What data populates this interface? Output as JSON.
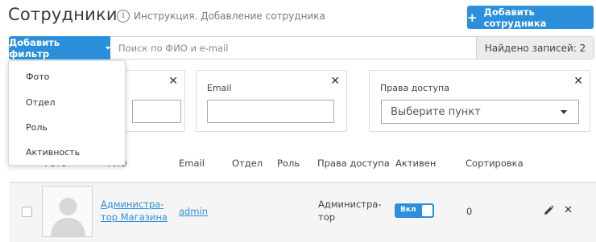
{
  "header": {
    "title": "Сотрудники",
    "help_icon": "info-icon",
    "help_link": "Инструкция. Добавление сотрудника",
    "add_button": "Добавить сотрудника"
  },
  "filter_bar": {
    "add_filter_label": "Добавить фильтр",
    "search_placeholder": "Поиск по ФИО и e-mail",
    "found_count": "Найдено записей: 2"
  },
  "filter_menu": {
    "items": [
      "Фото",
      "Отдел",
      "Роль",
      "Активность"
    ]
  },
  "filters": {
    "email_label": "Email",
    "rights_label": "Права доступа",
    "rights_placeholder": "Выберите пункт"
  },
  "table": {
    "columns": {
      "photo": "Фото",
      "name": "ФИО",
      "email": "Email",
      "department": "Отдел",
      "role": "Роль",
      "rights": "Права доступа",
      "active": "Активен",
      "sort": "Сортировка"
    },
    "rows": [
      {
        "name_line1": "Администра-",
        "name_line2": "тор Магазина",
        "email": "admin",
        "department": "",
        "role": "",
        "rights_line1": "Администра-",
        "rights_line2": "тор",
        "active_label": "Вкл",
        "active": true,
        "sort": "0"
      }
    ]
  },
  "colors": {
    "accent": "#2b8fdc",
    "count_bg": "#ececec",
    "row_bg": "#f5f5f5"
  }
}
